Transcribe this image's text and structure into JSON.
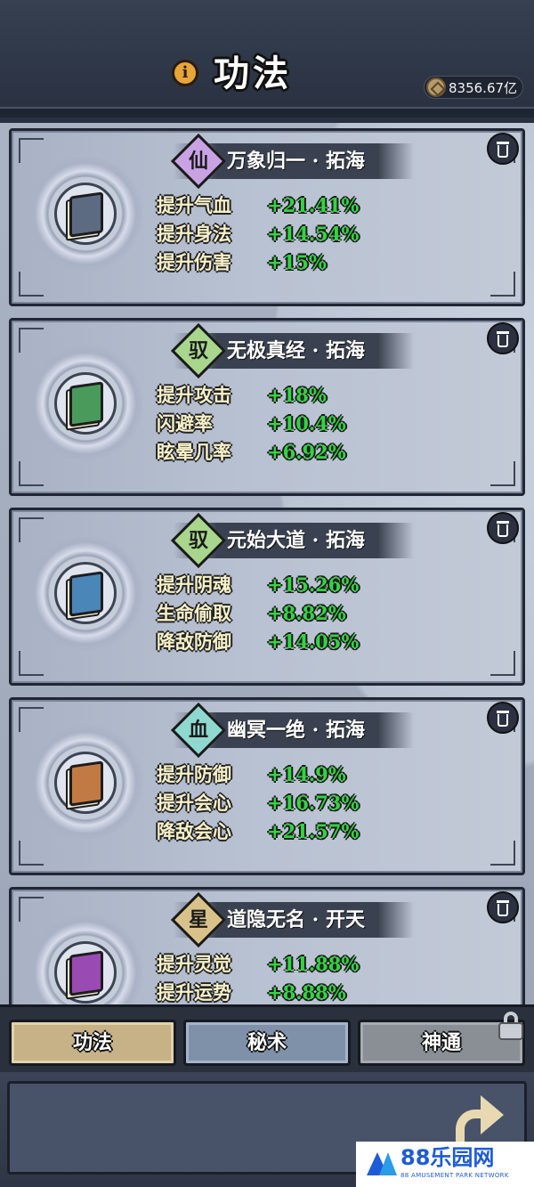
{
  "header": {
    "title": "功法",
    "info_icon_glyph": "i",
    "currency_amount": "8356.67亿"
  },
  "colors": {
    "stat_label": "#f6f0c8",
    "stat_value": "#33d442",
    "tiers": {
      "仙": {
        "badge": "#c9a2e4",
        "book": "#5c6b82"
      },
      "驭": {
        "badge": "#a7d68c",
        "book": "#4a9a5c"
      },
      "驭2": {
        "badge": "#a7d68c",
        "book": "#4a86b8"
      },
      "血": {
        "badge": "#8fd8d0",
        "book": "#c27a45"
      },
      "星": {
        "badge": "#d9c28a",
        "book": "#9a4bb3"
      }
    }
  },
  "skills": [
    {
      "tier": "仙",
      "name": "万象归一 · 拓海",
      "badge_color": "#c9a2e4",
      "book_color": "#5c6b82",
      "stats": [
        {
          "label": "提升气血",
          "value": "+21.41%"
        },
        {
          "label": "提升身法",
          "value": "+14.54%"
        },
        {
          "label": "提升伤害",
          "value": "+15%"
        }
      ]
    },
    {
      "tier": "驭",
      "name": "无极真经 · 拓海",
      "badge_color": "#a7d68c",
      "book_color": "#4a9a5c",
      "stats": [
        {
          "label": "提升攻击",
          "value": "+18%"
        },
        {
          "label": "闪避率",
          "value": "+10.4%"
        },
        {
          "label": "眩晕几率",
          "value": "+6.92%"
        }
      ]
    },
    {
      "tier": "驭",
      "name": "元始大道 · 拓海",
      "badge_color": "#a7d68c",
      "book_color": "#4a86b8",
      "stats": [
        {
          "label": "提升阴魂",
          "value": "+15.26%"
        },
        {
          "label": "生命偷取",
          "value": "+8.82%"
        },
        {
          "label": "降敌防御",
          "value": "+14.05%"
        }
      ]
    },
    {
      "tier": "血",
      "name": "幽冥一绝 · 拓海",
      "badge_color": "#8fd8d0",
      "book_color": "#c27a45",
      "stats": [
        {
          "label": "提升防御",
          "value": "+14.9%"
        },
        {
          "label": "提升会心",
          "value": "+16.73%"
        },
        {
          "label": "降敌会心",
          "value": "+21.57%"
        }
      ]
    },
    {
      "tier": "星",
      "name": "道隐无名 · 开天",
      "badge_color": "#d9c28a",
      "book_color": "#9a4bb3",
      "stats": [
        {
          "label": "提升灵觉",
          "value": "+11.88%"
        },
        {
          "label": "提升运势",
          "value": "+8.88%"
        }
      ]
    }
  ],
  "tabs": {
    "gongfa": "功法",
    "mishu": "秘术",
    "shentong": "神通"
  },
  "watermark": {
    "text": "88乐园网",
    "sub": "88 AMUSEMENT PARK NETWORK"
  }
}
